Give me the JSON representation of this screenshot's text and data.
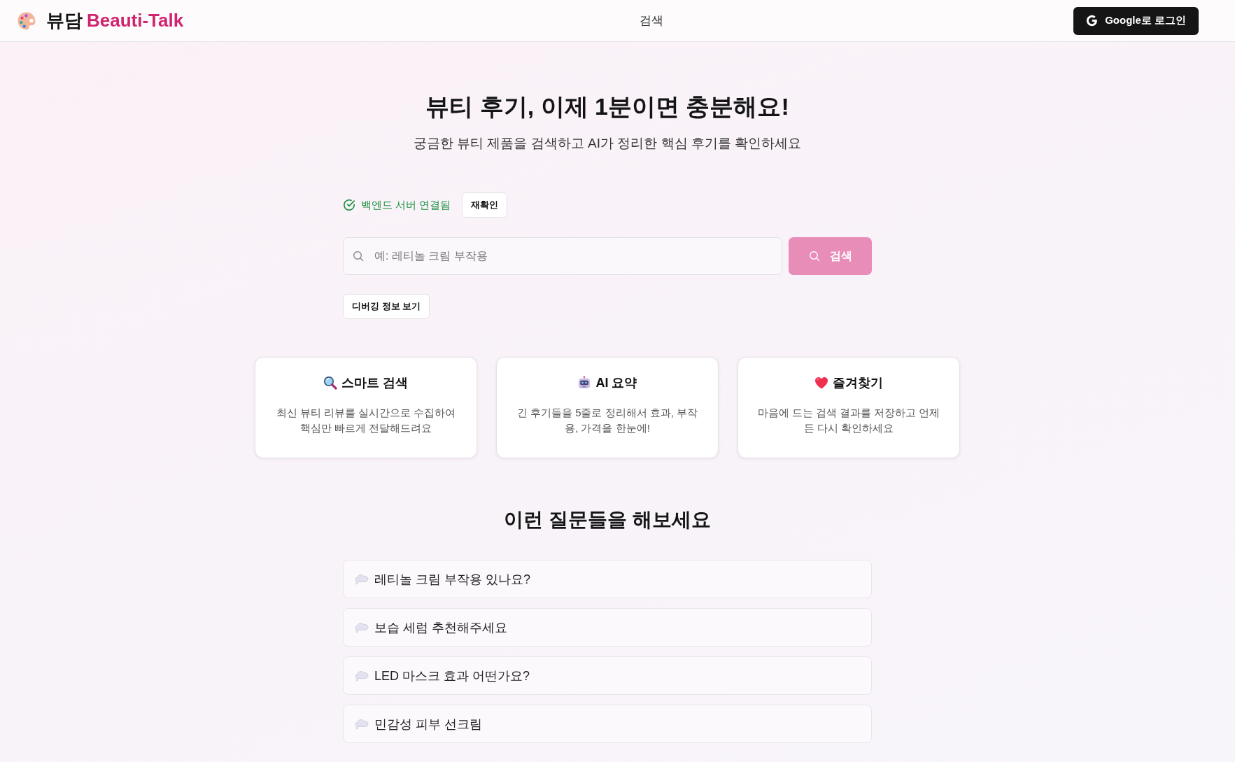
{
  "header": {
    "brand": {
      "prefix": "뷰담",
      "name": "Beauti-Talk"
    },
    "nav": [
      {
        "label": "검색"
      }
    ],
    "login_button": "Google로 로그인"
  },
  "hero": {
    "title": "뷰티 후기, 이제 1분이면 충분해요!",
    "subtitle": "궁금한 뷰티 제품을 검색하고 AI가 정리한 핵심 후기를 확인하세요"
  },
  "server_status": {
    "text": "백엔드 서버 연결됨",
    "connected": true,
    "recheck_button": "재확인"
  },
  "search": {
    "placeholder": "예: 레티놀 크림 부작용",
    "button": "검색",
    "disabled": true
  },
  "debug_button": "디버깅 정보 보기",
  "features": [
    {
      "kind": "search",
      "title": "스마트 검색",
      "description": "최신 뷰티 리뷰를 실시간으로 수집하여 핵심만 빠르게 전달해드려요"
    },
    {
      "kind": "robot",
      "title": "AI 요약",
      "description": "긴 후기들을 5줄로 정리해서 효과, 부작용, 가격을 한눈에!"
    },
    {
      "kind": "heart",
      "title": "즐겨찾기",
      "description": "마음에 드는 검색 결과를 저장하고 언제든 다시 확인하세요"
    }
  ],
  "examples": {
    "title": "이런 질문들을 해보세요",
    "items": [
      "레티놀 크림 부작용 있나요?",
      "보습 세럼 추천해주세요",
      "LED 마스크 효과 어떤가요?",
      "민감성 피부 선크림"
    ]
  }
}
